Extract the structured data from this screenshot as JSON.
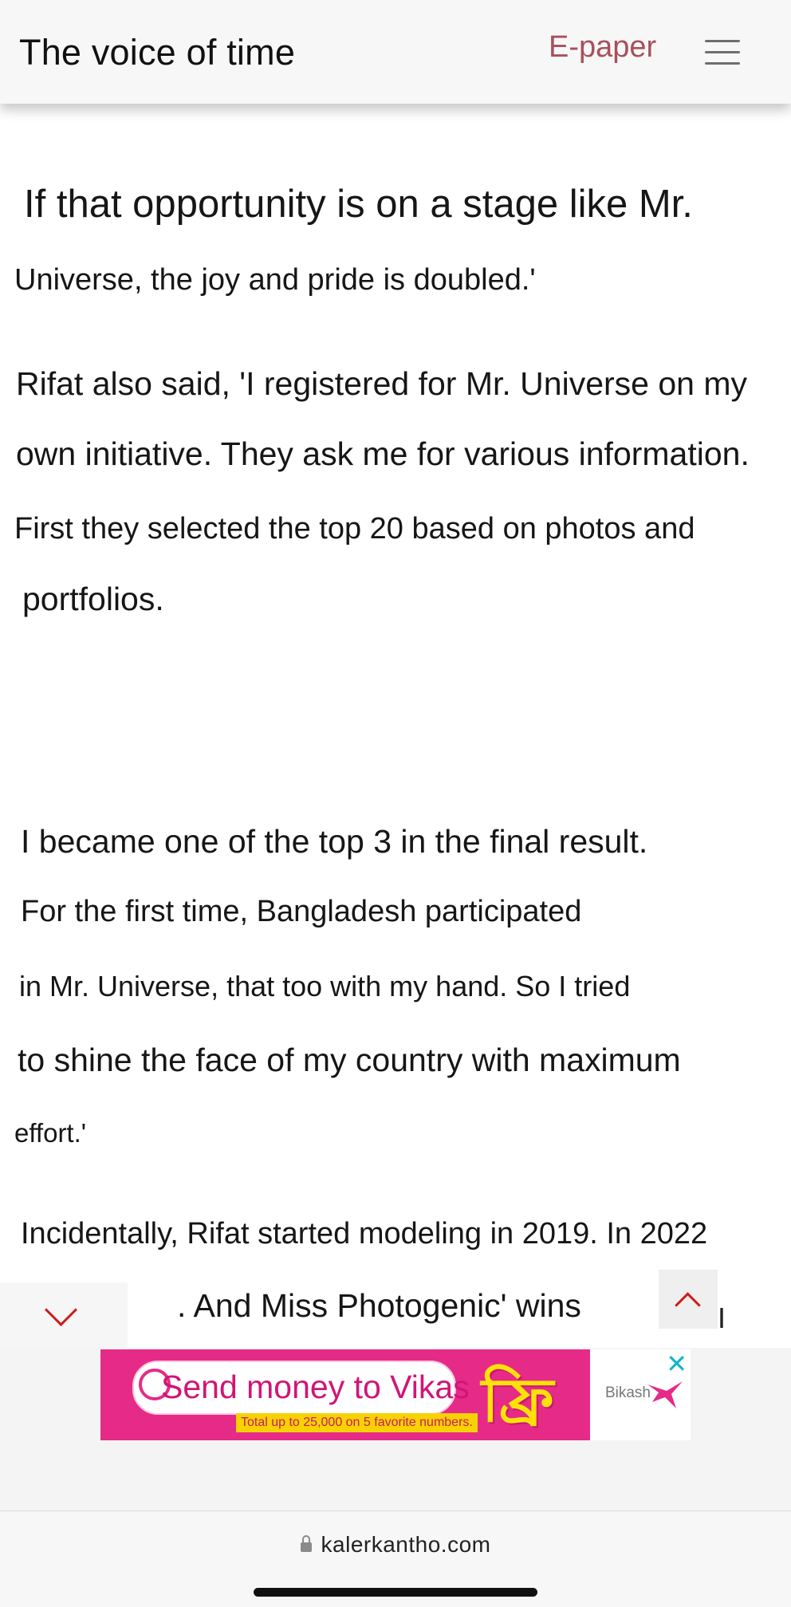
{
  "header": {
    "site_title": "The voice of time",
    "epaper_label": "E-paper",
    "menu_icon": "hamburger-menu-icon"
  },
  "article": {
    "lines": [
      "If that opportunity is on a stage like Mr.",
      "Universe, the joy and pride is doubled.'",
      "Rifat also said, 'I registered for Mr. Universe on my",
      "own initiative. They ask me for various information.",
      "First they selected the top 20 based on photos and",
      "portfolios.",
      "I became one of the top 3 in the final result.",
      "For the first time, Bangladesh participated",
      "in Mr. Universe, that too with my hand. So I tried",
      "to shine the face of my country with maximum",
      "effort.'",
      "Incidentally, Rifat started modeling in 2019. In 2022",
      ". And Miss Photogenic' wins"
    ]
  },
  "controls": {
    "scroll_down_icon": "chevron-down-icon",
    "scroll_up_icon": "chevron-up-icon",
    "text_cursor": "I"
  },
  "ad": {
    "headline": "Send money to Vikas",
    "free_text": "ফ্রি",
    "fineprint": "Total up to 25,000 on 5 favorite numbers.",
    "brand": "Bikash",
    "close_glyph": "✕",
    "accent_color": "#e62a87"
  },
  "browser": {
    "url": "kalerkantho.com",
    "lock_icon": "lock-icon"
  }
}
